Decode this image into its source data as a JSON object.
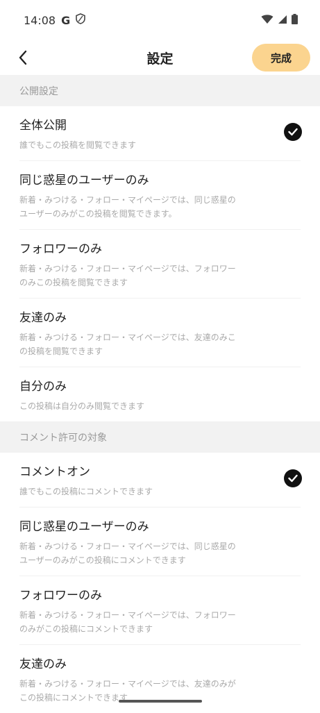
{
  "status": {
    "time": "14:08",
    "g_label": "G"
  },
  "header": {
    "title": "設定",
    "done_label": "完成"
  },
  "sections": [
    {
      "title": "公開設定",
      "options": [
        {
          "title": "全体公開",
          "desc": "誰でもこの投稿を閲覧できます",
          "selected": true
        },
        {
          "title": "同じ惑星のユーザーのみ",
          "desc": "新着・みつける・フォロー・マイページでは、同じ惑星の\nユーザーのみがこの投稿を閲覧できます。",
          "selected": false
        },
        {
          "title": "フォロワーのみ",
          "desc": "新着・みつける・フォロー・マイページでは、フォロワー\nのみこの投稿を閲覧できます",
          "selected": false
        },
        {
          "title": "友達のみ",
          "desc": "新着・みつける・フォロー・マイページでは、友達のみこ\nの投稿を閲覧できます",
          "selected": false
        },
        {
          "title": "自分のみ",
          "desc": "この投稿は自分のみ閲覧できます",
          "selected": false
        }
      ]
    },
    {
      "title": "コメント許可の対象",
      "options": [
        {
          "title": "コメントオン",
          "desc": "誰でもこの投稿にコメントできます",
          "selected": true
        },
        {
          "title": "同じ惑星のユーザーのみ",
          "desc": "新着・みつける・フォロー・マイページでは、同じ惑星の\nユーザーのみがこの投稿にコメントできます",
          "selected": false
        },
        {
          "title": "フォロワーのみ",
          "desc": "新着・みつける・フォロー・マイページでは、フォロワー\nのみがこの投稿にコメントできます",
          "selected": false
        },
        {
          "title": "友達のみ",
          "desc": "新着・みつける・フォロー・マイページでは、友達のみが\nこの投稿にコメントできます",
          "selected": false
        }
      ]
    }
  ]
}
